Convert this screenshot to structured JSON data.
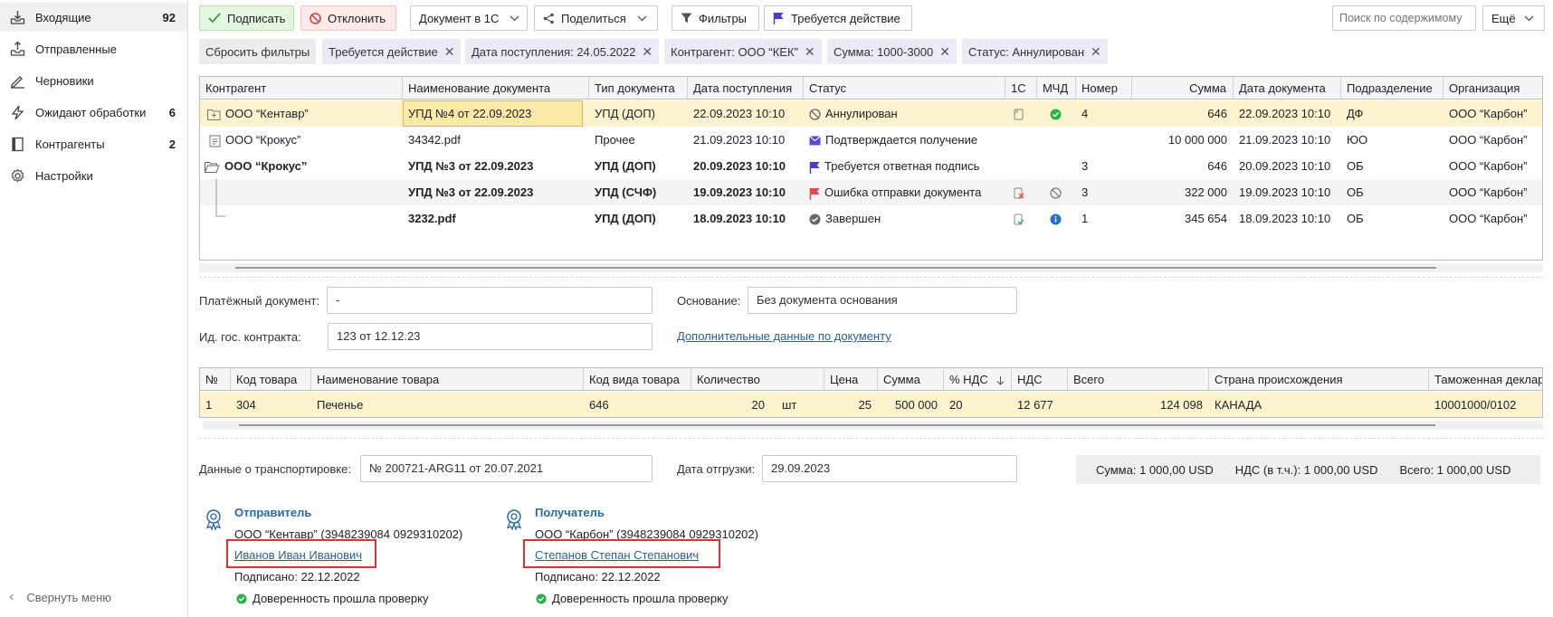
{
  "sidebar": {
    "items": [
      {
        "label": "Входящие",
        "count": "92",
        "icon": "inbox-download-icon"
      },
      {
        "label": "Отправленные",
        "count": "",
        "icon": "outbox-upload-icon"
      },
      {
        "label": "Черновики",
        "count": "",
        "icon": "pencil-icon"
      },
      {
        "label": "Ожидают обработки",
        "count": "6",
        "icon": "lightning-icon"
      },
      {
        "label": "Контрагенты",
        "count": "2",
        "icon": "book-icon"
      },
      {
        "label": "Настройки",
        "count": "",
        "icon": "gear-icon"
      }
    ],
    "collapse_label": "Свернуть меню"
  },
  "toolbar": {
    "sign_label": "Подписать",
    "reject_label": "Отклонить",
    "doc1c_label": "Документ в 1С",
    "share_label": "Поделиться",
    "filters_label": "Фильтры",
    "action_label": "Требуется действие",
    "search_placeholder": "Поиск по содержимому",
    "more_label": "Ещё"
  },
  "chips": {
    "reset": "Сбросить фильтры",
    "items": [
      "Требуется действие",
      "Дата поступления: 24.05.2022",
      "Контрагент: ООО “КЕК”",
      "Сумма: 1000-3000",
      "Статус: Аннулирован"
    ]
  },
  "docs_table": {
    "headers": [
      "Контрагент",
      "Наименование документа",
      "Тип документа",
      "Дата поступления",
      "Статус",
      "1С",
      "МЧД",
      "Номер",
      "Сумма",
      "Дата документа",
      "Подразделение",
      "Организация"
    ],
    "rows": [
      {
        "contractor": "ООО “Кентавр”",
        "name": "УПД №4 от 22.09.2023",
        "type": "УПД (ДОП)",
        "received": "22.09.2023 10:10",
        "status": "Аннулирован",
        "number": "4",
        "sum": "646",
        "doc_date": "22.09.2023 10:10",
        "dept": "ДФ",
        "org": "ООО “Карбон”"
      },
      {
        "contractor": "ООО “Крокус”",
        "name": "34342.pdf",
        "type": "Прочее",
        "received": "21.09.2023 10:10",
        "status": "Подтверждается получение",
        "number": "",
        "sum": "10 000 000",
        "doc_date": "21.09.2023 10:10",
        "dept": "ЮО",
        "org": "ООО “Карбон”"
      },
      {
        "contractor": "ООО “Крокус”",
        "name": "УПД №3 от 22.09.2023",
        "type": "УПД (ДОП)",
        "received": "20.09.2023 10:10",
        "status": "Требуется ответная подпись",
        "number": "3",
        "sum": "646",
        "doc_date": "20.09.2023 10:10",
        "dept": "ОБ",
        "org": "ООО “Карбон”"
      },
      {
        "contractor": "",
        "name": "УПД №3 от 22.09.2023",
        "type": "УПД (СЧФ)",
        "received": "19.09.2023 10:10",
        "status": "Ошибка отправки документа",
        "number": "3",
        "sum": "322 000",
        "doc_date": "19.09.2023 10:10",
        "dept": "ОБ",
        "org": "ООО “Карбон”"
      },
      {
        "contractor": "",
        "name": "3232.pdf",
        "type": "УПД (ДОП)",
        "received": "18.09.2023 10:10",
        "status": "Завершен",
        "number": "1",
        "sum": "345 654",
        "doc_date": "18.09.2023 10:10",
        "dept": "ОБ",
        "org": "ООО “Карбон”"
      }
    ]
  },
  "form": {
    "payment_label": "Платёжный документ:",
    "payment_value": "-",
    "basis_label": "Основание:",
    "basis_value": "Без документа основания",
    "contract_label": "Ид. гос. контракта:",
    "contract_value": "123 от 12.12.23",
    "extra_link": "Дополнительные данные по документу"
  },
  "goods_table": {
    "headers": [
      "№",
      "Код товара",
      "Наименование товара",
      "Код вида товара",
      "Количество",
      "Цена",
      "Сумма",
      "% НДС",
      "НДС",
      "Всего",
      "Страна происхождения",
      "Таможенная декларация"
    ],
    "rows": [
      {
        "n": "1",
        "code": "304",
        "name": "Печенье",
        "kind": "646",
        "qty": "20",
        "unit": "шт",
        "price": "25",
        "sum": "500 000",
        "vat_pct": "20",
        "vat": "12 677",
        "total": "124 098",
        "country": "КАНАДА",
        "customs": "10001000/0102"
      }
    ]
  },
  "transport": {
    "label": "Данные о транспортировке:",
    "value": "№ 200721-ARG11 от 20.07.2021",
    "ship_label": "Дата отгрузки:",
    "ship_value": "29.09.2023"
  },
  "totals": {
    "sum": "Сумма:  1 000,00 USD",
    "vat": "НДС (в т.ч.):  1 000,00 USD",
    "total": "Всего:  1 000,00 USD"
  },
  "sender": {
    "title": "Отправитель",
    "org": "ООО “Кентавр” (3948239084 0929310202)",
    "person": "Иванов Иван Иванович",
    "signed": "Подписано: 22.12.2022",
    "poa": "Доверенность прошла проверку"
  },
  "receiver": {
    "title": "Получатель",
    "org": "ООО “Карбон” (3948239084 0929310202)",
    "person": "Степанов Степан Степанович",
    "signed": "Подписано: 22.12.2022",
    "poa": "Доверенность прошла проверку"
  }
}
